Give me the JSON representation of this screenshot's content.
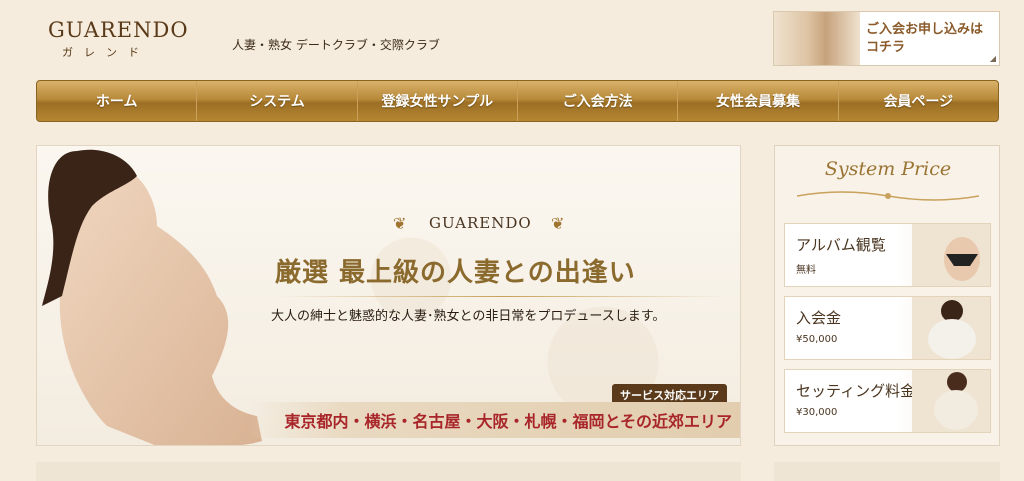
{
  "header": {
    "logo_main": "GUARENDO",
    "logo_sub": "ガレンド",
    "tagline": "人妻・熟女 デートクラブ・交際クラブ",
    "join_line1": "ご入会お申し込みは",
    "join_line2": "コチラ"
  },
  "nav": {
    "items": [
      "ホーム",
      "システム",
      "登録女性サンプル",
      "ご入会方法",
      "女性会員募集",
      "会員ページ"
    ]
  },
  "hero": {
    "brand": "GUARENDO",
    "title": "厳選 最上級の人妻との出逢い",
    "subtitle": "大人の紳士と魅惑的な人妻･熟女との非日常をプロデュースします。",
    "area_label": "サービス対応エリア",
    "area_text": "東京都内・横浜・名古屋・大阪・札幌・福岡とその近郊エリア"
  },
  "side": {
    "title": "System Price",
    "prices": [
      {
        "name": "アルバム観覧",
        "value": "無料"
      },
      {
        "name": "入会金",
        "value": "¥50,000"
      },
      {
        "name": "セッティング料金",
        "value": "¥30,000"
      }
    ]
  },
  "colors": {
    "accent": "#b88a3a",
    "area_text": "#a8262a",
    "background": "#f5ecdd"
  }
}
